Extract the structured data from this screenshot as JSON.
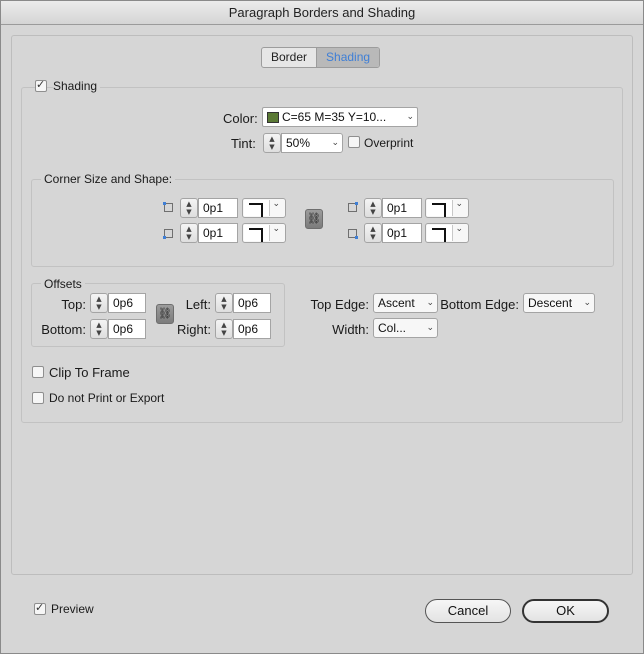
{
  "window": {
    "title": "Paragraph Borders and Shading"
  },
  "tabs": [
    {
      "label": "Border",
      "active": false
    },
    {
      "label": "Shading",
      "active": true
    }
  ],
  "shading": {
    "checkbox_label": "Shading",
    "checked": true,
    "color_label": "Color:",
    "color_value": "C=65 M=35 Y=10...",
    "color_swatch": "#5b7a35",
    "tint_label": "Tint:",
    "tint_value": "50%",
    "overprint_label": "Overprint",
    "overprint_checked": false
  },
  "corners": {
    "group_label": "Corner Size and Shape:",
    "top_left": "0p1",
    "bottom_left": "0p1",
    "top_right": "0p1",
    "bottom_right": "0p1"
  },
  "offsets": {
    "group_label": "Offsets",
    "top_label": "Top:",
    "top_value": "0p6",
    "bottom_label": "Bottom:",
    "bottom_value": "0p6",
    "left_label": "Left:",
    "left_value": "0p6",
    "right_label": "Right:",
    "right_value": "0p6"
  },
  "edges": {
    "top_edge_label": "Top Edge:",
    "top_edge_value": "Ascent",
    "bottom_edge_label": "Bottom Edge:",
    "bottom_edge_value": "Descent",
    "width_label": "Width:",
    "width_value": "Col..."
  },
  "options": {
    "clip_label": "Clip To Frame",
    "clip_checked": false,
    "no_print_label": "Do not Print or Export",
    "no_print_checked": false
  },
  "footer": {
    "preview_label": "Preview",
    "preview_checked": true,
    "cancel_label": "Cancel",
    "ok_label": "OK"
  },
  "icons": {
    "link": "chain-link-icon",
    "chevron": "chevron-down-icon",
    "stepper": "up-down-stepper-icon"
  }
}
